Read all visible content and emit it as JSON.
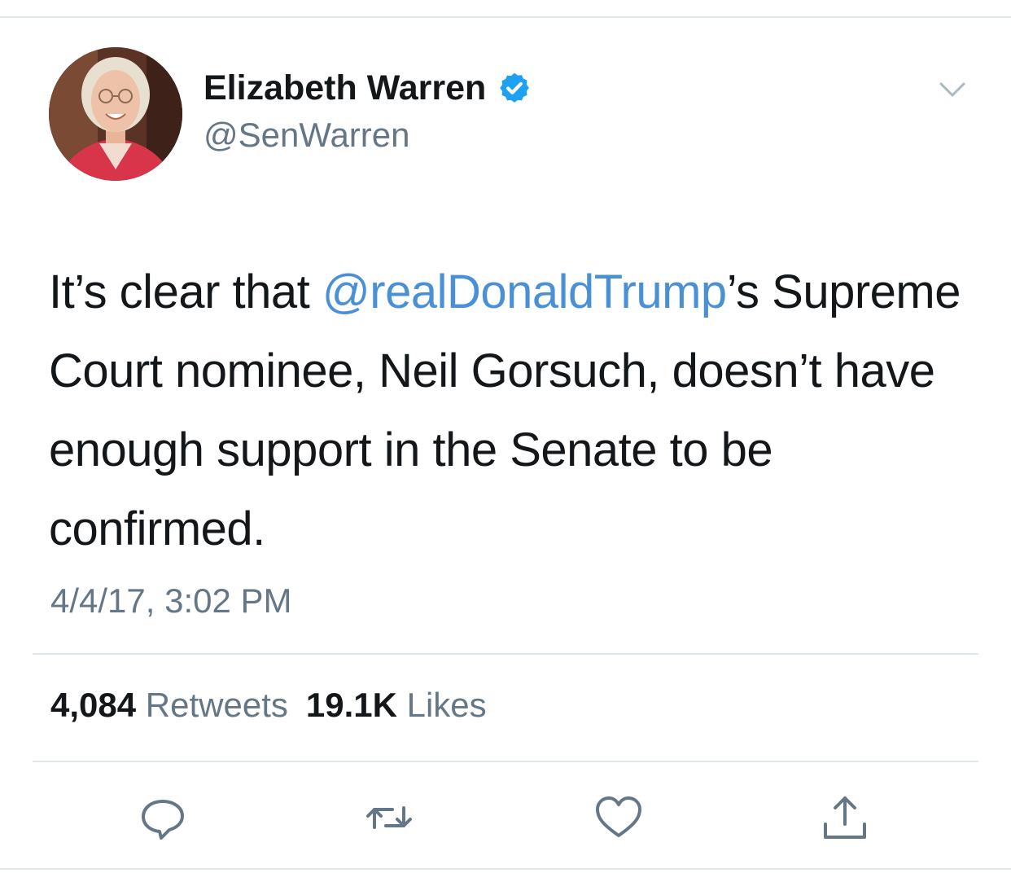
{
  "tweet": {
    "author": {
      "display_name": "Elizabeth Warren",
      "handle": "@SenWarren",
      "verified": true
    },
    "text_parts": {
      "before_mention": "It’s clear that ",
      "mention": "@realDonaldTrump",
      "after_mention": "’s Supreme Court nominee, Neil Gorsuch, doesn’t have enough support in the Senate to be confirmed."
    },
    "timestamp": "4/4/17, 3:02 PM",
    "stats": {
      "retweets_count": "4,084",
      "retweets_label": "Retweets",
      "likes_count": "19.1K",
      "likes_label": "Likes"
    }
  },
  "icons": {
    "verified": "verified-badge-icon",
    "more": "chevron-down-icon",
    "reply": "reply-icon",
    "retweet": "retweet-icon",
    "like": "heart-icon",
    "share": "share-icon"
  },
  "colors": {
    "text": "#14171a",
    "secondary": "#657786",
    "mention": "#4a90d6",
    "verified": "#1da1f2",
    "divider": "#e1e8ed"
  }
}
